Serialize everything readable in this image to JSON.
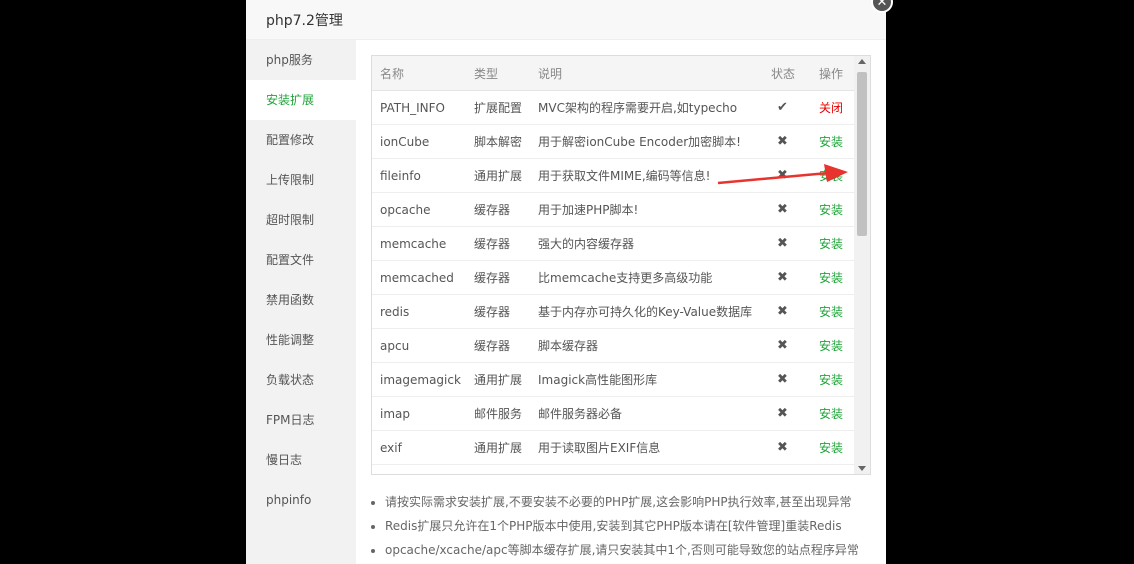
{
  "dialog": {
    "title": "php7.2管理",
    "close_glyph": "✕"
  },
  "sidebar": {
    "items": [
      {
        "label": "php服务"
      },
      {
        "label": "安装扩展"
      },
      {
        "label": "配置修改"
      },
      {
        "label": "上传限制"
      },
      {
        "label": "超时限制"
      },
      {
        "label": "配置文件"
      },
      {
        "label": "禁用函数"
      },
      {
        "label": "性能调整"
      },
      {
        "label": "负载状态"
      },
      {
        "label": "FPM日志"
      },
      {
        "label": "慢日志"
      },
      {
        "label": "phpinfo"
      }
    ],
    "active_index": 1
  },
  "table": {
    "headers": {
      "name": "名称",
      "type": "类型",
      "desc": "说明",
      "status": "状态",
      "op": "操作"
    },
    "rows": [
      {
        "name": "PATH_INFO",
        "type": "扩展配置",
        "desc": "MVC架构的程序需要开启,如typecho",
        "status": "✔",
        "op": "关闭"
      },
      {
        "name": "ionCube",
        "type": "脚本解密",
        "desc": "用于解密ionCube Encoder加密脚本!",
        "status": "✖",
        "op": "安装"
      },
      {
        "name": "fileinfo",
        "type": "通用扩展",
        "desc": "用于获取文件MIME,编码等信息!",
        "status": "✖",
        "op": "安装"
      },
      {
        "name": "opcache",
        "type": "缓存器",
        "desc": "用于加速PHP脚本!",
        "status": "✖",
        "op": "安装"
      },
      {
        "name": "memcache",
        "type": "缓存器",
        "desc": "强大的内容缓存器",
        "status": "✖",
        "op": "安装"
      },
      {
        "name": "memcached",
        "type": "缓存器",
        "desc": "比memcache支持更多高级功能",
        "status": "✖",
        "op": "安装"
      },
      {
        "name": "redis",
        "type": "缓存器",
        "desc": "基于内存亦可持久化的Key-Value数据库",
        "status": "✖",
        "op": "安装"
      },
      {
        "name": "apcu",
        "type": "缓存器",
        "desc": "脚本缓存器",
        "status": "✖",
        "op": "安装"
      },
      {
        "name": "imagemagick",
        "type": "通用扩展",
        "desc": "Imagick高性能图形库",
        "status": "✖",
        "op": "安装"
      },
      {
        "name": "imap",
        "type": "邮件服务",
        "desc": "邮件服务器必备",
        "status": "✖",
        "op": "安装"
      },
      {
        "name": "exif",
        "type": "通用扩展",
        "desc": "用于读取图片EXIF信息",
        "status": "✖",
        "op": "安装"
      }
    ]
  },
  "notes": [
    "请按实际需求安装扩展,不要安装不必要的PHP扩展,这会影响PHP执行效率,甚至出现异常",
    "Redis扩展只允许在1个PHP版本中使用,安装到其它PHP版本请在[软件管理]重装Redis",
    "opcache/xcache/apc等脚本缓存扩展,请只安装其中1个,否则可能导致您的站点程序异常"
  ],
  "colors": {
    "accent": "#20a53a",
    "danger": "#e00000",
    "annotation_arrow": "#e8332e"
  }
}
